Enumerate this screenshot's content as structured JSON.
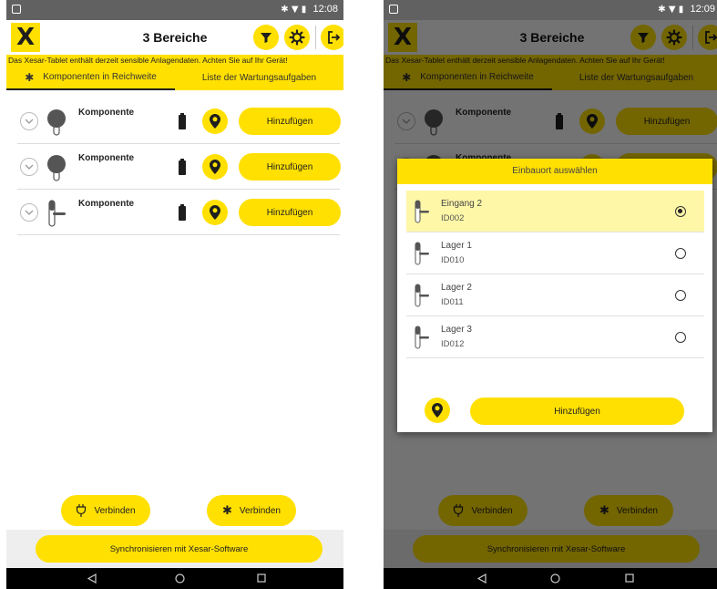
{
  "status": {
    "left_time": "12:08",
    "right_time": "12:09",
    "icons": [
      "bluetooth-icon",
      "wifi-icon",
      "battery-icon"
    ]
  },
  "header": {
    "logo_letter": "X",
    "title": "3 Bereiche"
  },
  "warning": "Das Xesar-Tablet enthält derzeit sensible Anlagendaten. Achten Sie auf Ihr Gerät!",
  "tabs": [
    {
      "label": "Komponenten in Reichweite",
      "active": true
    },
    {
      "label": "Liste der Wartungsaufgaben",
      "active": false
    }
  ],
  "components": [
    {
      "label": "Komponente",
      "icon": "cylinder-icon",
      "action": "Hinzufügen"
    },
    {
      "label": "Komponente",
      "icon": "cylinder-icon",
      "action": "Hinzufügen"
    },
    {
      "label": "Komponente",
      "icon": "door-handle-icon",
      "action": "Hinzufügen"
    }
  ],
  "bottom": {
    "connect_usb": "Verbinden",
    "connect_bt": "Verbinden",
    "sync": "Synchronisieren mit Xesar-Software"
  },
  "dialog": {
    "title": "Einbauort auswählen",
    "options": [
      {
        "name": "Eingang 2",
        "id": "ID002",
        "selected": true
      },
      {
        "name": "Lager 1",
        "id": "ID010",
        "selected": false
      },
      {
        "name": "Lager 2",
        "id": "ID011",
        "selected": false
      },
      {
        "name": "Lager 3",
        "id": "ID012",
        "selected": false
      }
    ],
    "add_label": "Hinzufügen"
  },
  "colors": {
    "accent": "#ffe000",
    "dark": "#1e1e1e",
    "statusbar": "#616161",
    "selected_row": "#fff7a8"
  }
}
